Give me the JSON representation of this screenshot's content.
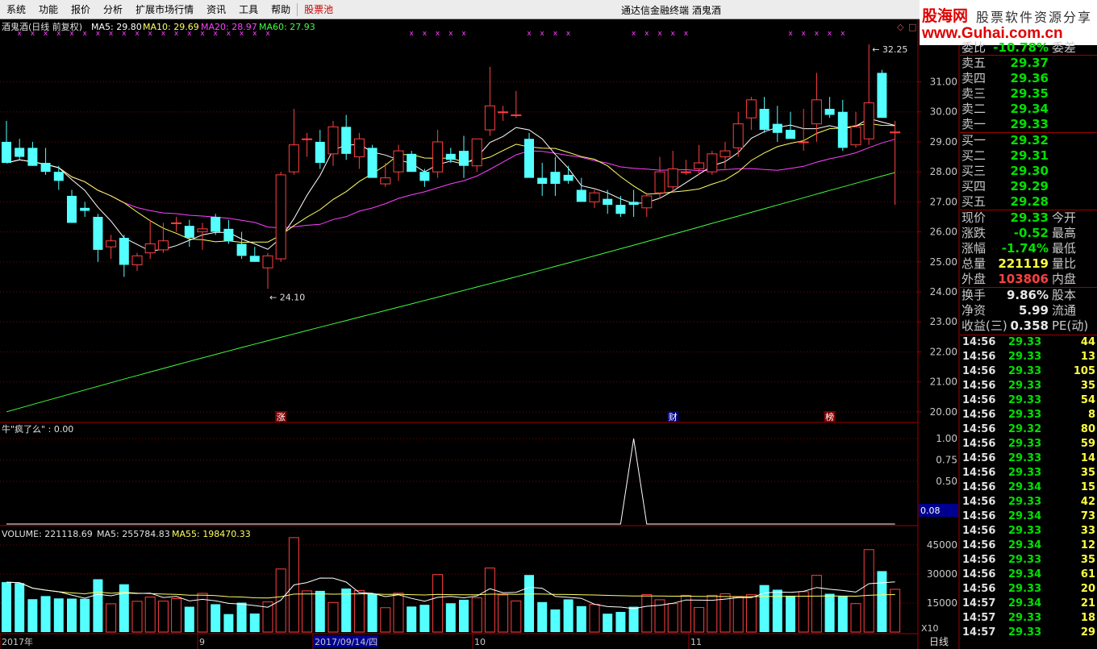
{
  "menubar": {
    "items": [
      "系统",
      "功能",
      "报价",
      "分析",
      "扩展市场行情",
      "资讯",
      "工具",
      "帮助",
      "股票池"
    ],
    "active_index": 8
  },
  "app_title": "通达信金融终端   酒鬼酒",
  "logo": {
    "line1_red": "股海网",
    "line1_gray": "股票软件资源分享",
    "line2": "www.Guhai.com.cn"
  },
  "main_chart": {
    "header": {
      "name": "酒鬼酒(日线 前复权)",
      "ma5_label": "MA5: 29.80",
      "ma10_label": "MA10: 29.69",
      "ma20_label": "MA20: 28.97",
      "ma60_label": "MA60: 27.93"
    },
    "y_ticks": [
      "31.00",
      "30.00",
      "29.00",
      "28.00",
      "27.00",
      "26.00",
      "25.00",
      "24.00",
      "23.00",
      "22.00",
      "21.00",
      "20.00"
    ],
    "high_marker": "32.25",
    "low_marker": "24.10",
    "event_markers": [
      "涨",
      "财",
      "榜"
    ],
    "colors": {
      "up": "#ff4040",
      "down": "#54ffff",
      "ma5": "#ffffff",
      "ma10": "#ffff60",
      "ma20": "#ff40ff",
      "ma60": "#40ff40",
      "grid": "#800000"
    }
  },
  "indicator": {
    "label": "牛\"疯了么\" : 0.00",
    "y_ticks": [
      "1.00",
      "0.75",
      "0.50"
    ],
    "current_value": "0.08"
  },
  "volume_panel": {
    "label_volume": "VOLUME: 221118.69",
    "label_ma5": "MA5: 255784.83",
    "label_ma55": "MA55: 198470.33",
    "y_ticks": [
      "45000",
      "30000",
      "15000"
    ],
    "unit": "X10"
  },
  "date_axis": {
    "labels": [
      "2017年",
      "9",
      "2017/09/14/四",
      "10",
      "11"
    ],
    "period_button": "日线"
  },
  "chart_data": {
    "type": "candlestick",
    "title": "酒鬼酒(日线 前复权)",
    "ylim": [
      19.7,
      32.6
    ],
    "candles": [
      {
        "o": 29.0,
        "h": 29.7,
        "l": 28.4,
        "c": 28.3,
        "v": 25800
      },
      {
        "o": 28.8,
        "h": 29.1,
        "l": 28.4,
        "c": 28.5,
        "v": 25300
      },
      {
        "o": 28.8,
        "h": 29.0,
        "l": 28.2,
        "c": 28.2,
        "v": 17000
      },
      {
        "o": 28.3,
        "h": 28.8,
        "l": 27.9,
        "c": 28.0,
        "v": 18600
      },
      {
        "o": 28.0,
        "h": 28.2,
        "l": 27.4,
        "c": 27.7,
        "v": 17400
      },
      {
        "o": 27.2,
        "h": 27.4,
        "l": 26.3,
        "c": 26.3,
        "v": 17300
      },
      {
        "o": 26.8,
        "h": 27.0,
        "l": 26.5,
        "c": 26.7,
        "v": 17200
      },
      {
        "o": 26.5,
        "h": 26.6,
        "l": 25.0,
        "c": 25.4,
        "v": 27300
      },
      {
        "o": 25.5,
        "h": 25.9,
        "l": 25.1,
        "c": 25.7,
        "v": 14600
      },
      {
        "o": 25.8,
        "h": 25.9,
        "l": 24.5,
        "c": 24.9,
        "v": 24700
      },
      {
        "o": 24.9,
        "h": 25.3,
        "l": 24.7,
        "c": 25.2,
        "v": 15900
      },
      {
        "o": 25.3,
        "h": 26.4,
        "l": 25.1,
        "c": 25.6,
        "v": 18100
      },
      {
        "o": 25.4,
        "h": 26.3,
        "l": 25.3,
        "c": 25.7,
        "v": 16000
      },
      {
        "o": 26.3,
        "h": 26.5,
        "l": 26.0,
        "c": 26.3,
        "v": 17300
      },
      {
        "o": 26.2,
        "h": 26.4,
        "l": 25.5,
        "c": 25.8,
        "v": 13100
      },
      {
        "o": 26.0,
        "h": 26.3,
        "l": 25.4,
        "c": 26.1,
        "v": 20000
      },
      {
        "o": 26.5,
        "h": 26.6,
        "l": 25.9,
        "c": 26.0,
        "v": 14400
      },
      {
        "o": 26.1,
        "h": 26.4,
        "l": 25.6,
        "c": 25.7,
        "v": 9300
      },
      {
        "o": 25.6,
        "h": 26.0,
        "l": 25.1,
        "c": 25.2,
        "v": 15200
      },
      {
        "o": 25.2,
        "h": 25.5,
        "l": 25.0,
        "c": 25.0,
        "v": 9600
      },
      {
        "o": 24.8,
        "h": 25.3,
        "l": 24.1,
        "c": 25.2,
        "v": 15600
      },
      {
        "o": 25.1,
        "h": 28.0,
        "l": 25.0,
        "c": 27.9,
        "v": 32600
      },
      {
        "o": 28.0,
        "h": 30.1,
        "l": 27.9,
        "c": 28.9,
        "v": 48800
      },
      {
        "o": 29.1,
        "h": 29.3,
        "l": 28.5,
        "c": 29.1,
        "v": 21300
      },
      {
        "o": 29.0,
        "h": 29.4,
        "l": 28.1,
        "c": 28.3,
        "v": 21300
      },
      {
        "o": 28.6,
        "h": 29.7,
        "l": 28.2,
        "c": 29.5,
        "v": 15300
      },
      {
        "o": 29.5,
        "h": 29.9,
        "l": 28.4,
        "c": 28.6,
        "v": 22500
      },
      {
        "o": 28.5,
        "h": 29.3,
        "l": 28.1,
        "c": 29.1,
        "v": 21500
      },
      {
        "o": 28.8,
        "h": 28.9,
        "l": 27.8,
        "c": 27.8,
        "v": 19700
      },
      {
        "o": 27.6,
        "h": 28.3,
        "l": 27.5,
        "c": 27.8,
        "v": 12600
      },
      {
        "o": 28.0,
        "h": 28.9,
        "l": 27.7,
        "c": 28.7,
        "v": 20100
      },
      {
        "o": 28.6,
        "h": 28.7,
        "l": 28.0,
        "c": 28.0,
        "v": 13200
      },
      {
        "o": 28.0,
        "h": 28.1,
        "l": 27.5,
        "c": 27.7,
        "v": 14100
      },
      {
        "o": 28.0,
        "h": 29.4,
        "l": 27.8,
        "c": 29.0,
        "v": 29700
      },
      {
        "o": 28.6,
        "h": 28.8,
        "l": 28.3,
        "c": 28.4,
        "v": 14900
      },
      {
        "o": 28.7,
        "h": 29.2,
        "l": 27.8,
        "c": 28.2,
        "v": 16700
      },
      {
        "o": 28.2,
        "h": 29.1,
        "l": 28.0,
        "c": 29.1,
        "v": 17700
      },
      {
        "o": 29.4,
        "h": 31.5,
        "l": 29.2,
        "c": 30.2,
        "v": 33100
      },
      {
        "o": 30.0,
        "h": 30.2,
        "l": 29.7,
        "c": 30.0,
        "v": 19200
      },
      {
        "o": 29.9,
        "h": 30.7,
        "l": 29.8,
        "c": 29.9,
        "v": 16100
      },
      {
        "o": 29.1,
        "h": 29.3,
        "l": 27.9,
        "c": 27.8,
        "v": 29500
      },
      {
        "o": 27.8,
        "h": 28.3,
        "l": 27.2,
        "c": 27.6,
        "v": 15500
      },
      {
        "o": 28.0,
        "h": 28.5,
        "l": 27.2,
        "c": 27.6,
        "v": 11700
      },
      {
        "o": 27.9,
        "h": 28.2,
        "l": 27.6,
        "c": 27.7,
        "v": 16900
      },
      {
        "o": 27.4,
        "h": 27.8,
        "l": 27.1,
        "c": 27.0,
        "v": 13400
      },
      {
        "o": 27.0,
        "h": 27.4,
        "l": 26.8,
        "c": 27.3,
        "v": 14300
      },
      {
        "o": 27.1,
        "h": 27.4,
        "l": 26.6,
        "c": 26.9,
        "v": 9500
      },
      {
        "o": 26.9,
        "h": 27.2,
        "l": 26.5,
        "c": 26.6,
        "v": 10400
      },
      {
        "o": 27.0,
        "h": 27.4,
        "l": 26.5,
        "c": 26.9,
        "v": 13100
      },
      {
        "o": 26.8,
        "h": 27.3,
        "l": 26.5,
        "c": 27.2,
        "v": 19400
      },
      {
        "o": 27.3,
        "h": 28.5,
        "l": 27.1,
        "c": 28.0,
        "v": 16700
      },
      {
        "o": 27.5,
        "h": 28.7,
        "l": 27.3,
        "c": 28.1,
        "v": 14700
      },
      {
        "o": 28.0,
        "h": 28.4,
        "l": 27.9,
        "c": 28.0,
        "v": 19000
      },
      {
        "o": 28.1,
        "h": 28.9,
        "l": 27.9,
        "c": 28.3,
        "v": 12700
      },
      {
        "o": 28.0,
        "h": 28.7,
        "l": 27.9,
        "c": 28.6,
        "v": 19000
      },
      {
        "o": 28.5,
        "h": 29.0,
        "l": 28.1,
        "c": 28.7,
        "v": 19800
      },
      {
        "o": 28.8,
        "h": 30.0,
        "l": 28.5,
        "c": 29.6,
        "v": 18400
      },
      {
        "o": 29.8,
        "h": 30.5,
        "l": 29.4,
        "c": 30.4,
        "v": 19300
      },
      {
        "o": 30.1,
        "h": 30.5,
        "l": 29.3,
        "c": 29.4,
        "v": 24300
      },
      {
        "o": 29.6,
        "h": 30.2,
        "l": 29.0,
        "c": 29.3,
        "v": 21900
      },
      {
        "o": 29.4,
        "h": 30.0,
        "l": 29.2,
        "c": 29.1,
        "v": 18800
      },
      {
        "o": 29.0,
        "h": 30.1,
        "l": 28.7,
        "c": 29.0,
        "v": 20900
      },
      {
        "o": 29.6,
        "h": 31.3,
        "l": 29.0,
        "c": 30.4,
        "v": 29300
      },
      {
        "o": 30.1,
        "h": 30.5,
        "l": 29.8,
        "c": 29.9,
        "v": 19800
      },
      {
        "o": 30.0,
        "h": 30.4,
        "l": 28.7,
        "c": 28.8,
        "v": 18700
      },
      {
        "o": 28.9,
        "h": 30.0,
        "l": 28.8,
        "c": 29.5,
        "v": 14700
      },
      {
        "o": 29.1,
        "h": 32.25,
        "l": 28.9,
        "c": 30.3,
        "v": 42600
      },
      {
        "o": 31.3,
        "h": 31.4,
        "l": 29.8,
        "c": 29.8,
        "v": 31500
      },
      {
        "o": 29.3,
        "h": 29.7,
        "l": 26.9,
        "c": 29.33,
        "v": 22100
      }
    ],
    "ma5_series": "MA5",
    "ma10_series": "MA10",
    "ma20_series": "MA20",
    "ma60_series": "MA60"
  },
  "quote": {
    "weibi_label": "委比",
    "weibi_value": "-10.78%",
    "weicha_label": "委差",
    "sells": [
      {
        "label": "卖五",
        "price": "29.37",
        "vol": ""
      },
      {
        "label": "卖四",
        "price": "29.36",
        "vol": ""
      },
      {
        "label": "卖三",
        "price": "29.35",
        "vol": ""
      },
      {
        "label": "卖二",
        "price": "29.34",
        "vol": ""
      },
      {
        "label": "卖一",
        "price": "29.33",
        "vol": ""
      }
    ],
    "buys": [
      {
        "label": "买一",
        "price": "29.32",
        "vol": ""
      },
      {
        "label": "买二",
        "price": "29.31",
        "vol": ""
      },
      {
        "label": "买三",
        "price": "29.30",
        "vol": ""
      },
      {
        "label": "买四",
        "price": "29.29",
        "vol": ""
      },
      {
        "label": "买五",
        "price": "29.28",
        "vol": ""
      }
    ],
    "stats": [
      {
        "label": "现价",
        "value": "29.33",
        "color": "green",
        "label2": "今开"
      },
      {
        "label": "涨跌",
        "value": "-0.52",
        "color": "green",
        "label2": "最高"
      },
      {
        "label": "涨幅",
        "value": "-1.74%",
        "color": "green",
        "label2": "最低"
      },
      {
        "label": "总量",
        "value": "221119",
        "color": "yellow",
        "label2": "量比"
      },
      {
        "label": "外盘",
        "value": "103806",
        "color": "red",
        "label2": "内盘"
      }
    ],
    "stats2": [
      {
        "label": "换手",
        "value": "9.86%",
        "color": "white",
        "label2": "股本"
      },
      {
        "label": "净资",
        "value": "5.99",
        "color": "white",
        "label2": "流通"
      },
      {
        "label": "收益(三)",
        "value": "0.358",
        "color": "white",
        "label2": "PE(动)"
      }
    ]
  },
  "ticks": [
    {
      "time": "14:56",
      "price": "29.33",
      "vol": "44"
    },
    {
      "time": "14:56",
      "price": "29.33",
      "vol": "13"
    },
    {
      "time": "14:56",
      "price": "29.33",
      "vol": "105"
    },
    {
      "time": "14:56",
      "price": "29.33",
      "vol": "35"
    },
    {
      "time": "14:56",
      "price": "29.33",
      "vol": "54"
    },
    {
      "time": "14:56",
      "price": "29.33",
      "vol": "8"
    },
    {
      "time": "14:56",
      "price": "29.32",
      "vol": "80"
    },
    {
      "time": "14:56",
      "price": "29.33",
      "vol": "59"
    },
    {
      "time": "14:56",
      "price": "29.33",
      "vol": "14"
    },
    {
      "time": "14:56",
      "price": "29.33",
      "vol": "35"
    },
    {
      "time": "14:56",
      "price": "29.34",
      "vol": "15"
    },
    {
      "time": "14:56",
      "price": "29.33",
      "vol": "42"
    },
    {
      "time": "14:56",
      "price": "29.34",
      "vol": "73"
    },
    {
      "time": "14:56",
      "price": "29.33",
      "vol": "33"
    },
    {
      "time": "14:56",
      "price": "29.34",
      "vol": "12"
    },
    {
      "time": "14:56",
      "price": "29.33",
      "vol": "35"
    },
    {
      "time": "14:56",
      "price": "29.34",
      "vol": "61"
    },
    {
      "time": "14:56",
      "price": "29.33",
      "vol": "20"
    },
    {
      "time": "14:57",
      "price": "29.34",
      "vol": "21"
    },
    {
      "time": "14:57",
      "price": "29.33",
      "vol": "18"
    },
    {
      "time": "14:57",
      "price": "29.33",
      "vol": "29"
    }
  ]
}
